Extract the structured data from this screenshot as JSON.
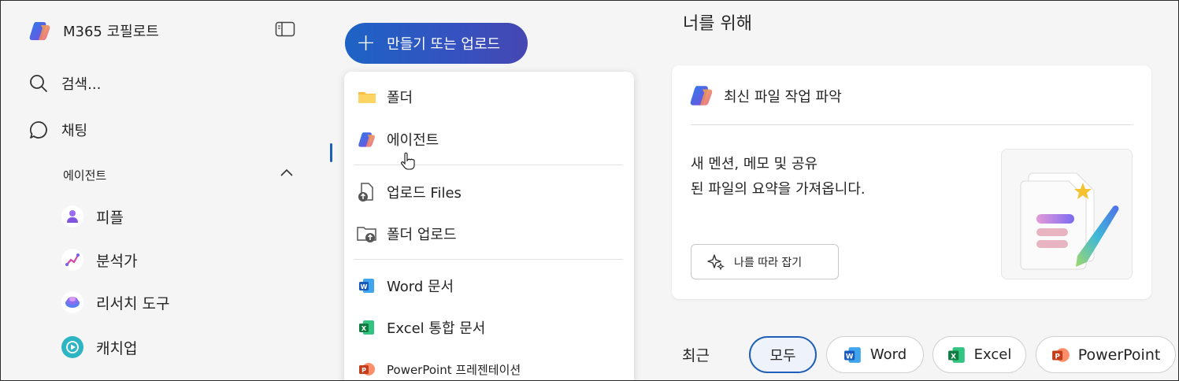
{
  "sidebar": {
    "app_title": "M365 코필로트",
    "nav": [
      {
        "label": "검색...",
        "icon": "search-icon"
      },
      {
        "label": "채팅",
        "icon": "chat-icon"
      }
    ],
    "agents_header": "에이전트",
    "agents": [
      {
        "label": "피플",
        "icon": "people-agent-icon"
      },
      {
        "label": "분석가",
        "icon": "analyst-agent-icon"
      },
      {
        "label": "리서치 도구",
        "icon": "researcher-agent-icon"
      },
      {
        "label": "캐치업",
        "icon": "catchup-agent-icon"
      }
    ]
  },
  "create_button": {
    "label": "만들기 또는 업로드",
    "icon": "plus-icon"
  },
  "menu": {
    "items": [
      {
        "label": "폴더",
        "icon": "folder-icon"
      },
      {
        "label": "에이전트",
        "icon": "copilot-icon"
      },
      {
        "label": "업로드 Files",
        "icon": "upload-file-icon"
      },
      {
        "label": "폴더 업로드",
        "icon": "upload-folder-icon"
      },
      {
        "label": "Word 문서",
        "icon": "word-icon"
      },
      {
        "label": "Excel 통합 문서",
        "icon": "excel-icon"
      },
      {
        "label": "PowerPoint 프레젠테이션",
        "icon": "powerpoint-icon"
      }
    ]
  },
  "for_you": {
    "title": "너를 위해",
    "card": {
      "title": "최신 파일 작업 파악",
      "description_line1": "새 멘션, 메모 및 공유",
      "description_line2": "된 파일의 요약을 가져옵니다.",
      "button_label": "나를 따라 잡기"
    }
  },
  "recent": {
    "label": "최근",
    "filters": [
      {
        "label": "모두",
        "selected": true
      },
      {
        "label": "Word",
        "icon": "word-icon"
      },
      {
        "label": "Excel",
        "icon": "excel-icon"
      },
      {
        "label": "PowerPoint",
        "icon": "powerpoint-icon"
      }
    ]
  },
  "colors": {
    "accent": "#1f5fb8",
    "word": "#185abd",
    "excel": "#107c41",
    "powerpoint": "#c43e1c"
  }
}
